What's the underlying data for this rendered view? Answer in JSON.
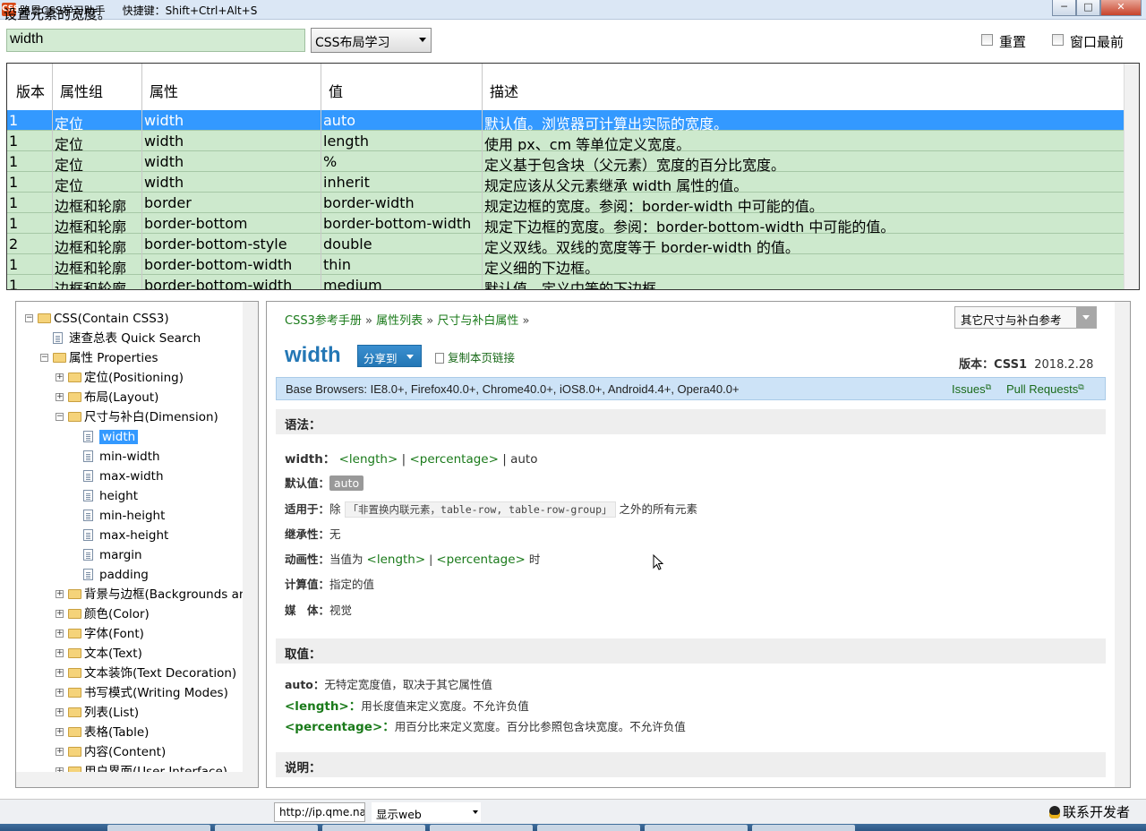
{
  "window": {
    "title": "路恩CSS学习助手     快捷键：Shift+Ctrl+Alt+S",
    "app_icon": "CSS",
    "minimize": "─",
    "maximize": "□",
    "close": "✕"
  },
  "toolbar": {
    "search_value": "width",
    "category_selected": "CSS布局学习",
    "reset_label": "重置",
    "topmost_label": "窗口最前"
  },
  "grid": {
    "columns": [
      "版本",
      "属性组",
      "属性",
      "值",
      "描述"
    ],
    "rows": [
      [
        "1",
        "定位",
        "width",
        "auto",
        "默认值。浏览器可计算出实际的宽度。"
      ],
      [
        "1",
        "定位",
        "width",
        "length",
        "使用 px、cm 等单位定义宽度。"
      ],
      [
        "1",
        "定位",
        "width",
        "%",
        "定义基于包含块（父元素）宽度的百分比宽度。"
      ],
      [
        "1",
        "定位",
        "width",
        "inherit",
        "规定应该从父元素继承 width 属性的值。"
      ],
      [
        "1",
        "边框和轮廓",
        "border",
        "border-width",
        "规定边框的宽度。参阅：border-width 中可能的值。"
      ],
      [
        "1",
        "边框和轮廓",
        "border-bottom",
        "border-bottom-width",
        "规定下边框的宽度。参阅：border-bottom-width 中可能的值。"
      ],
      [
        "2",
        "边框和轮廓",
        "border-bottom-style",
        "double",
        "定义双线。双线的宽度等于 border-width 的值。"
      ],
      [
        "1",
        "边框和轮廓",
        "border-bottom-width",
        "thin",
        "定义细的下边框。"
      ],
      [
        "1",
        "边框和轮廓",
        "border-bottom-width",
        "medium",
        "默认值。定义中等的下边框。"
      ]
    ],
    "selected_row": 0
  },
  "tree": {
    "root": "CSS(Contain CSS3)",
    "quick_search": "速查总表 Quick Search",
    "properties": "属性 Properties",
    "groups_before": [
      "定位(Positioning)",
      "布局(Layout)"
    ],
    "dimension": "尺寸与补白(Dimension)",
    "dimension_items": [
      "width",
      "min-width",
      "max-width",
      "height",
      "min-height",
      "max-height",
      "margin",
      "padding"
    ],
    "groups_after": [
      "背景与边框(Backgrounds and",
      "颜色(Color)",
      "字体(Font)",
      "文本(Text)",
      "文本装饰(Text Decoration)",
      "书写模式(Writing Modes)",
      "列表(List)",
      "表格(Table)",
      "内容(Content)",
      "用户界面(User Interface)"
    ]
  },
  "doc": {
    "breadcrumb": [
      "CSS3参考手册",
      "属性列表",
      "尺寸与补白属性"
    ],
    "breadcrumb_sep": "»",
    "related_select": "其它尺寸与补白参考",
    "prop_name": "width",
    "share_label": "分享到",
    "copy_link_label": "复制本页链接",
    "version_label": "版本：",
    "version_value": "CSS1",
    "version_date": "2018.2.28",
    "browsers": "Base Browsers: IE8.0+, Firefox40.0+, Chrome40.0+, iOS8.0+, Android4.4+, Opera40.0+",
    "issues": "Issues",
    "pull_requests": "Pull Requests",
    "syntax_title": "语法：",
    "syntax_key": "width：",
    "syntax_values": [
      "<length>",
      "|",
      "<percentage>",
      "|",
      "auto"
    ],
    "default_key": "默认值：",
    "default_value": "auto",
    "applies_key": "适用于：",
    "applies_prefix": "除",
    "applies_code": "「非置换内联元素，table-row, table-row-group」",
    "applies_suffix": "之外的所有元素",
    "inherit_key": "继承性：",
    "inherit_value": "无",
    "anim_key": "动画性：",
    "anim_prefix": "当值为",
    "anim_v1": "<length>",
    "anim_sep": "|",
    "anim_v2": "<percentage>",
    "anim_suffix": "时",
    "computed_key": "计算值：",
    "computed_value": "指定的值",
    "media_key": "媒　体：",
    "media_value": "视觉",
    "values_title": "取值：",
    "values": [
      {
        "name": "auto：",
        "desc": "无特定宽度值，取决于其它属性值"
      },
      {
        "name": "<length>：",
        "desc": "用长度值来定义宽度。不允许负值"
      },
      {
        "name": "<percentage>：",
        "desc": "用百分比来定义宽度。百分比参照包含块宽度。不允许负值"
      }
    ],
    "notes_title": "说明："
  },
  "status": {
    "text": "设置元素的宽度。",
    "url": "http://ip.qme.na",
    "mode": "显示web",
    "contact": "联系开发者"
  },
  "colors": {
    "row_bg": "#cde9cd",
    "selection": "#3399ff",
    "link_green": "#1a7a1a",
    "title_blue": "#2477b5"
  }
}
